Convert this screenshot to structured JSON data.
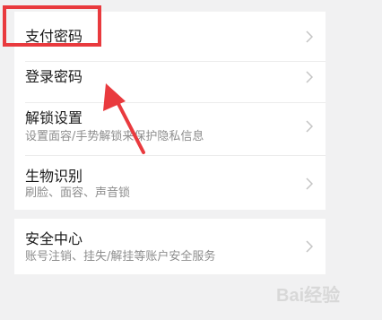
{
  "settings": {
    "items": [
      {
        "title": "支付密码",
        "subtitle": ""
      },
      {
        "title": "登录密码",
        "subtitle": ""
      },
      {
        "title": "解锁设置",
        "subtitle": "设置面容/手势解锁来保护隐私信息"
      },
      {
        "title": "生物识别",
        "subtitle": "刷脸、面容、声音锁"
      },
      {
        "title": "安全中心",
        "subtitle": "账号注销、挂失/解挂等账户安全服务"
      }
    ]
  },
  "annotation": {
    "highlight_color": "#e93a3e",
    "arrow_color": "#e93a3e"
  },
  "watermark": {
    "text": "Bai经验"
  },
  "colors": {
    "background": "#f1f1f2",
    "card": "#ffffff",
    "title": "#1a1a1a",
    "subtitle": "#8d8d8d",
    "chevron": "#c4c4c4"
  }
}
